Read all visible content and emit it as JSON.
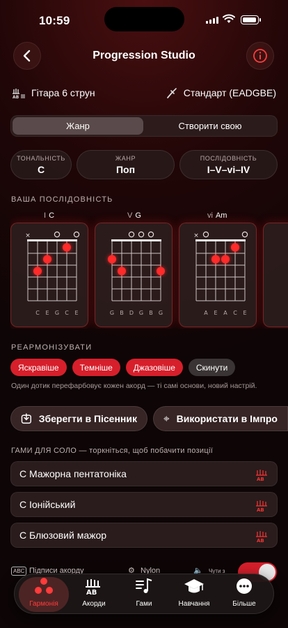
{
  "status": {
    "time": "10:59"
  },
  "nav": {
    "title": "Progression Studio",
    "back_icon": "chevron-left-icon",
    "info_icon": "info-icon"
  },
  "instrument": {
    "name": "Гітара 6 струн",
    "tuning": "Стандарт (EADGBE)"
  },
  "segment": {
    "items": [
      "Жанр",
      "Створити свою"
    ],
    "selected": "Жанр"
  },
  "params": [
    {
      "label": "ТОНАЛЬНІСТЬ",
      "value": "C"
    },
    {
      "label": "ЖАНР",
      "value": "Поп"
    },
    {
      "label": "ПОСЛІДОВНІСТЬ",
      "value": "I–V–vi–IV"
    }
  ],
  "progression": {
    "heading": "ВАША ПОСЛІДОВНІСТЬ",
    "chords": [
      {
        "degree": "I",
        "name": "C",
        "markers": [
          "x",
          "",
          "",
          "o",
          "",
          "o"
        ],
        "notes": [
          "C",
          "E",
          "G",
          "C",
          "E"
        ],
        "dots": [
          [
            2,
            3
          ],
          [
            3,
            2
          ],
          [
            5,
            1
          ]
        ]
      },
      {
        "degree": "V",
        "name": "G",
        "markers": [
          "",
          "",
          "o",
          "o",
          "o",
          ""
        ],
        "notes": [
          "G",
          "B",
          "D",
          "G",
          "B",
          "G"
        ],
        "dots": [
          [
            1,
            2
          ],
          [
            2,
            3
          ],
          [
            6,
            3
          ]
        ]
      },
      {
        "degree": "vi",
        "name": "Am",
        "markers": [
          "x",
          "o",
          "",
          "",
          "",
          "o"
        ],
        "notes": [
          "A",
          "E",
          "A",
          "C",
          "E"
        ],
        "dots": [
          [
            3,
            2
          ],
          [
            4,
            2
          ],
          [
            5,
            1
          ]
        ]
      }
    ]
  },
  "reharm": {
    "heading": "РЕАРМОНІЗУВАТИ",
    "buttons": [
      "Яскравіше",
      "Темніше",
      "Джазовіше",
      "Скинути"
    ],
    "note": "Один дотик перефарбовує кожен акорд — ті самі основи, новий настрій."
  },
  "actions": {
    "save": "Зберегти в Пісенник",
    "use": "Використати в Імпро"
  },
  "scales": {
    "heading": "ГАМИ ДЛЯ СОЛО — торкніться, щоб побачити позиції",
    "items": [
      "C Мажорна пентатоніка",
      "C Іонійський",
      "C Блюзовий мажор"
    ]
  },
  "toggles": {
    "chord_labels": "Підписи акорду",
    "nylon": "Nylon",
    "sound": "Чути з"
  },
  "tabs": [
    {
      "label": "Гармонія",
      "icon": "harmony-dots-icon"
    },
    {
      "label": "Акорди",
      "icon": "guitar-tab-icon"
    },
    {
      "label": "Гами",
      "icon": "music-note-list-icon"
    },
    {
      "label": "Навчання",
      "icon": "graduation-cap-icon"
    },
    {
      "label": "Більше",
      "icon": "more-icon"
    }
  ],
  "colors": {
    "accent": "#d61f2b",
    "accent_text": "#ff3b3b"
  }
}
